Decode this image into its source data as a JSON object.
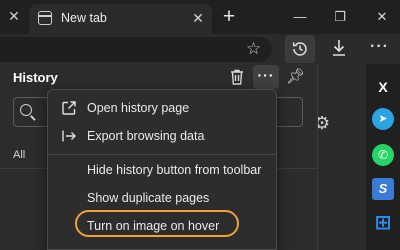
{
  "tab": {
    "title": "New tab",
    "close_glyph": "✕"
  },
  "tabstrip": {
    "outer_close_glyph": "✕",
    "new_tab_glyph": "+"
  },
  "window_controls": {
    "minimize": "—",
    "restore": "❐",
    "close": "✕"
  },
  "toolbar": {
    "favorite_icon": "star-outline",
    "history_icon": "history-clock",
    "download_icon": "download-arrow",
    "more_glyph": "···"
  },
  "history_panel": {
    "title": "History",
    "more_glyph": "···",
    "filter_all": "All",
    "filter_next_fragment": "I"
  },
  "menu": {
    "items": [
      {
        "label": "Open history page",
        "icon": "open-external-icon"
      },
      {
        "label": "Export browsing data",
        "icon": "export-arrow-icon"
      },
      {
        "label": "Hide history button from toolbar",
        "icon": ""
      },
      {
        "label": "Show duplicate pages",
        "icon": ""
      },
      {
        "label": "Turn on image on hover",
        "icon": "",
        "highlighted": true
      }
    ]
  },
  "sidebar": {
    "items": [
      {
        "name": "x",
        "glyph": "X",
        "color": "#ffffff"
      },
      {
        "name": "telegram",
        "glyph": "➤",
        "color": "#2aa4e2"
      },
      {
        "name": "whatsapp",
        "glyph": "✆",
        "color": "#25d366"
      },
      {
        "name": "s-app",
        "glyph": "S",
        "color": "#3a7bd5"
      },
      {
        "name": "windows",
        "glyph": "⊞",
        "color": "#2f8df0"
      }
    ]
  },
  "colors": {
    "highlight": "#f0a23a",
    "panel_bg": "#2c2c2c",
    "menu_bg": "#2d2d2d"
  }
}
